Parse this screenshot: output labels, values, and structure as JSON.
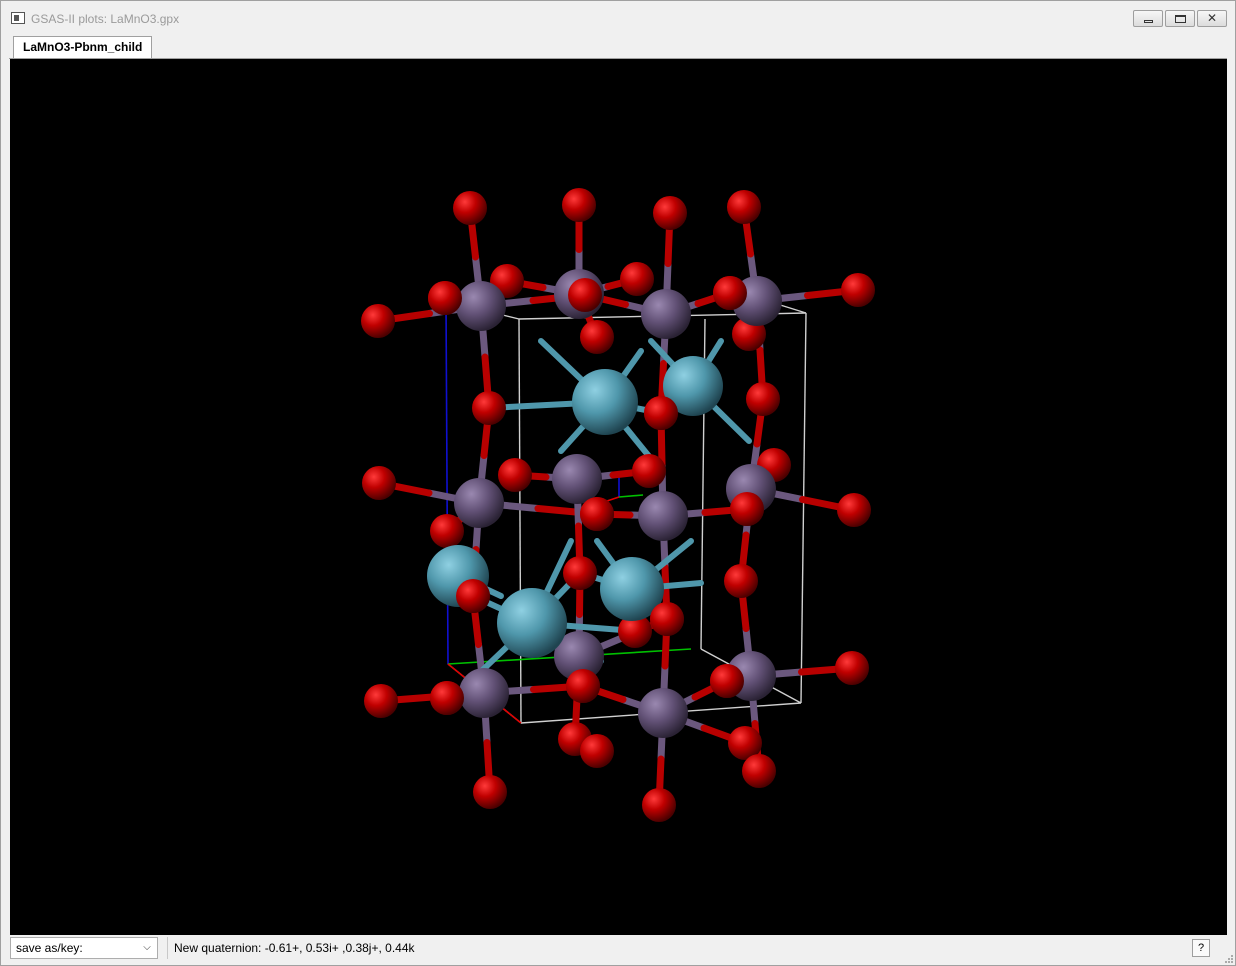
{
  "window": {
    "title": "GSAS-II plots: LaMnO3.gpx",
    "close_glyph": "✕"
  },
  "tabs": [
    {
      "label": "LaMnO3-Pbnm_child",
      "active": true
    }
  ],
  "statusbar": {
    "key_select_value": "save as/key:",
    "message": "New quaternion: -0.61+, 0.53i+ ,0.38j+, 0.44k",
    "help_label": "?"
  },
  "colors": {
    "background": "#000000",
    "oxygen": "#b80000",
    "manganese": "#6b587e",
    "lanthanum": "#4f97ab",
    "cell_edge": "#d0d0d0",
    "axis_a": "#e00000",
    "axis_b": "#00c000",
    "axis_c": "#1010d0"
  }
}
